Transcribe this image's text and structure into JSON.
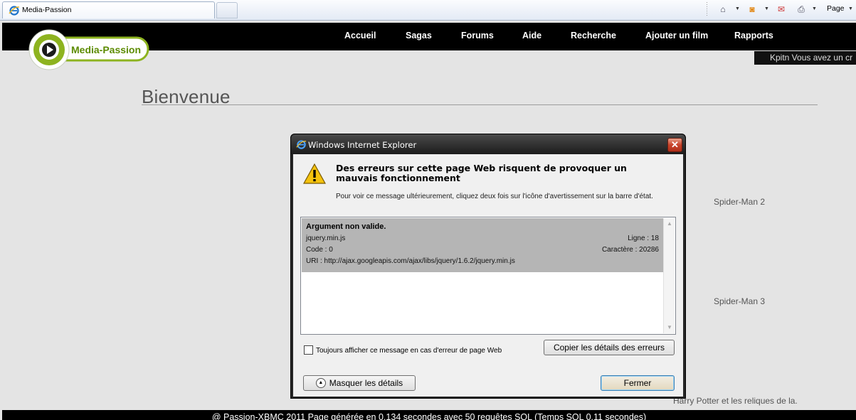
{
  "browser": {
    "tab_title": "Media-Passion",
    "toolbar": {
      "page_label": "Page"
    }
  },
  "site": {
    "logo_text": "Media-Passion",
    "nav": [
      "Accueil",
      "Sagas",
      "Forums",
      "Aide",
      "Recherche",
      "Ajouter un film",
      "Rapports"
    ],
    "user_strip": "Kpitn  Vous avez un cr",
    "page_title": "Bienvenue",
    "movies": [
      "Spider-Man 2",
      "Spider-Man 3",
      "Harry Potter et les reliques de la."
    ],
    "footer": "@ Passion-XBMC 2011 Page générée en 0.134 secondes avec 50 requêtes SQL (Temps SQL 0.11 secondes)"
  },
  "dialog": {
    "title": "Windows Internet Explorer",
    "heading": "Des erreurs sur cette page Web risquent de provoquer un mauvais fonctionnement",
    "hint": "Pour voir ce message ultérieurement, cliquez deux fois sur l'icône d'avertissement sur la barre d'état.",
    "error": {
      "title": "Argument non valide.",
      "file": "jquery.min.js",
      "line": "Ligne : 18",
      "code": "Code : 0",
      "char": "Caractère : 20286",
      "uri": "URI : http://ajax.googleapis.com/ajax/libs/jquery/1.6.2/jquery.min.js"
    },
    "checkbox_label": "Toujours afficher ce message en cas d'erreur de page Web",
    "checkbox_checked": false,
    "copy_button": "Copier les détails des erreurs",
    "hide_button": "Masquer les détails",
    "close_button": "Fermer"
  },
  "colors": {
    "nav_bg": "#000000",
    "logo_accent": "#8db31f",
    "dialog_frame": "#262626",
    "close_red": "#c8432a"
  }
}
